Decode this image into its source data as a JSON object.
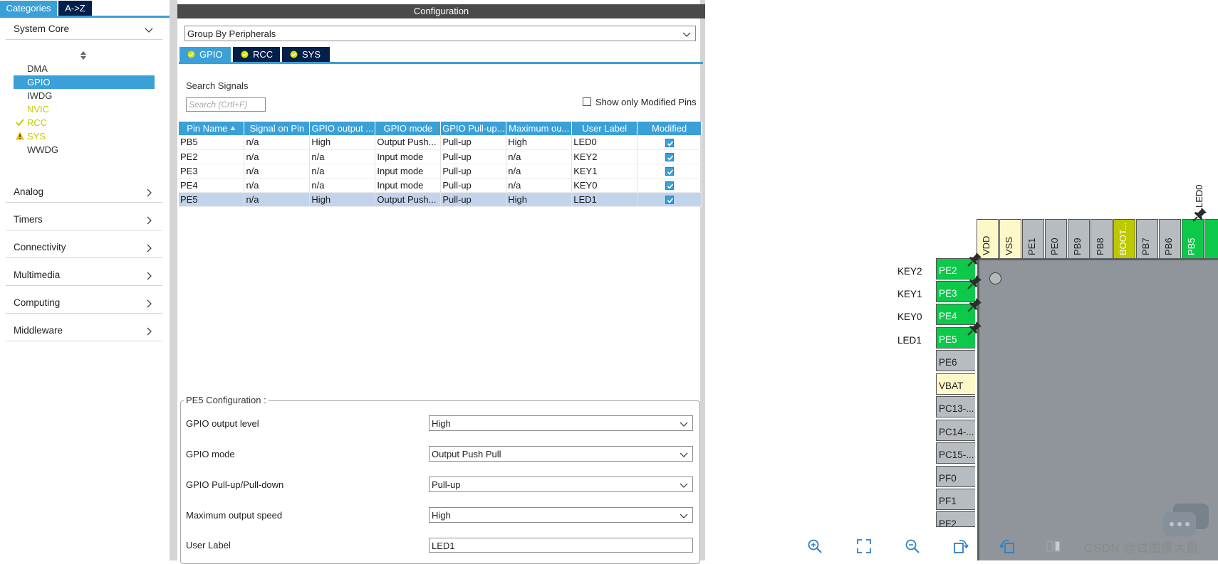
{
  "left_panel": {
    "tabs": [
      "Categories",
      "A->Z"
    ],
    "categories": [
      {
        "label": "System Core",
        "expanded": true
      },
      {
        "label": "Analog"
      },
      {
        "label": "Timers"
      },
      {
        "label": "Connectivity"
      },
      {
        "label": "Multimedia"
      },
      {
        "label": "Computing"
      },
      {
        "label": "Middleware"
      }
    ],
    "system_core_items": [
      {
        "label": "DMA",
        "state": "none"
      },
      {
        "label": "GPIO",
        "state": "selected"
      },
      {
        "label": "IWDG",
        "state": "none"
      },
      {
        "label": "NVIC",
        "state": "yellow"
      },
      {
        "label": "RCC",
        "state": "ok"
      },
      {
        "label": "SYS",
        "state": "warning"
      },
      {
        "label": "WWDG",
        "state": "none"
      }
    ]
  },
  "config": {
    "title": "Configuration",
    "group_by": "Group By Peripherals",
    "peripheral_tabs": [
      "GPIO",
      "RCC",
      "SYS"
    ],
    "search_label": "Search Signals",
    "search_placeholder": "Search (Crtl+F)",
    "show_modified_label": "Show only Modified Pins",
    "table": {
      "headers": [
        "Pin Name",
        "Signal on Pin",
        "GPIO output ...",
        "GPIO mode",
        "GPIO Pull-up...",
        "Maximum ou...",
        "User Label",
        "Modified"
      ],
      "rows": [
        [
          "PB5",
          "n/a",
          "High",
          "Output Push...",
          "Pull-up",
          "High",
          "LED0"
        ],
        [
          "PE2",
          "n/a",
          "n/a",
          "Input mode",
          "Pull-up",
          "n/a",
          "KEY2"
        ],
        [
          "PE3",
          "n/a",
          "n/a",
          "Input mode",
          "Pull-up",
          "n/a",
          "KEY1"
        ],
        [
          "PE4",
          "n/a",
          "n/a",
          "Input mode",
          "Pull-up",
          "n/a",
          "KEY0"
        ],
        [
          "PE5",
          "n/a",
          "High",
          "Output Push...",
          "Pull-up",
          "High",
          "LED1"
        ]
      ],
      "selected_row": 4
    },
    "pin_config": {
      "title": "PE5 Configuration :",
      "fields": [
        {
          "label": "GPIO output level",
          "value": "High"
        },
        {
          "label": "GPIO mode",
          "value": "Output Push Pull"
        },
        {
          "label": "GPIO Pull-up/Pull-down",
          "value": "Pull-up"
        },
        {
          "label": "Maximum output speed",
          "value": "High"
        },
        {
          "label": "User Label",
          "value": "LED1"
        }
      ]
    }
  },
  "pinout": {
    "left_pins": [
      {
        "name": "PE2",
        "label": "KEY2",
        "color": "green"
      },
      {
        "name": "PE3",
        "label": "KEY1",
        "color": "green"
      },
      {
        "name": "PE4",
        "label": "KEY0",
        "color": "green"
      },
      {
        "name": "PE5",
        "label": "LED1",
        "color": "green"
      },
      {
        "name": "PE6",
        "label": "",
        "color": "gray"
      },
      {
        "name": "VBAT",
        "label": "",
        "color": "cream"
      },
      {
        "name": "PC13-...",
        "label": "",
        "color": "gray"
      },
      {
        "name": "PC14-...",
        "label": "",
        "color": "gray"
      },
      {
        "name": "PC15-...",
        "label": "",
        "color": "gray"
      },
      {
        "name": "PF0",
        "label": "",
        "color": "gray"
      },
      {
        "name": "PF1",
        "label": "",
        "color": "gray"
      },
      {
        "name": "PF2",
        "label": "",
        "color": "gray"
      }
    ],
    "top_pins": [
      {
        "name": "VDD",
        "color": "cream"
      },
      {
        "name": "VSS",
        "color": "cream"
      },
      {
        "name": "PE1",
        "color": "gray"
      },
      {
        "name": "PE0",
        "color": "gray"
      },
      {
        "name": "PB9",
        "color": "gray"
      },
      {
        "name": "PB8",
        "color": "gray"
      },
      {
        "name": "BOOT...",
        "color": "olive"
      },
      {
        "name": "PB7",
        "color": "gray"
      },
      {
        "name": "PB6",
        "color": "gray"
      },
      {
        "name": "PB5",
        "color": "green"
      }
    ],
    "top_pin_label": "LED0",
    "watermark": "CSDN @试图摸大鱼",
    "colors": {
      "green": "#0cc94a",
      "gray": "#b7bcc0",
      "cream": "#fdf8c8",
      "olive": "#bcc800",
      "accent": "#3aa0d8",
      "navy": "#02204a"
    }
  }
}
